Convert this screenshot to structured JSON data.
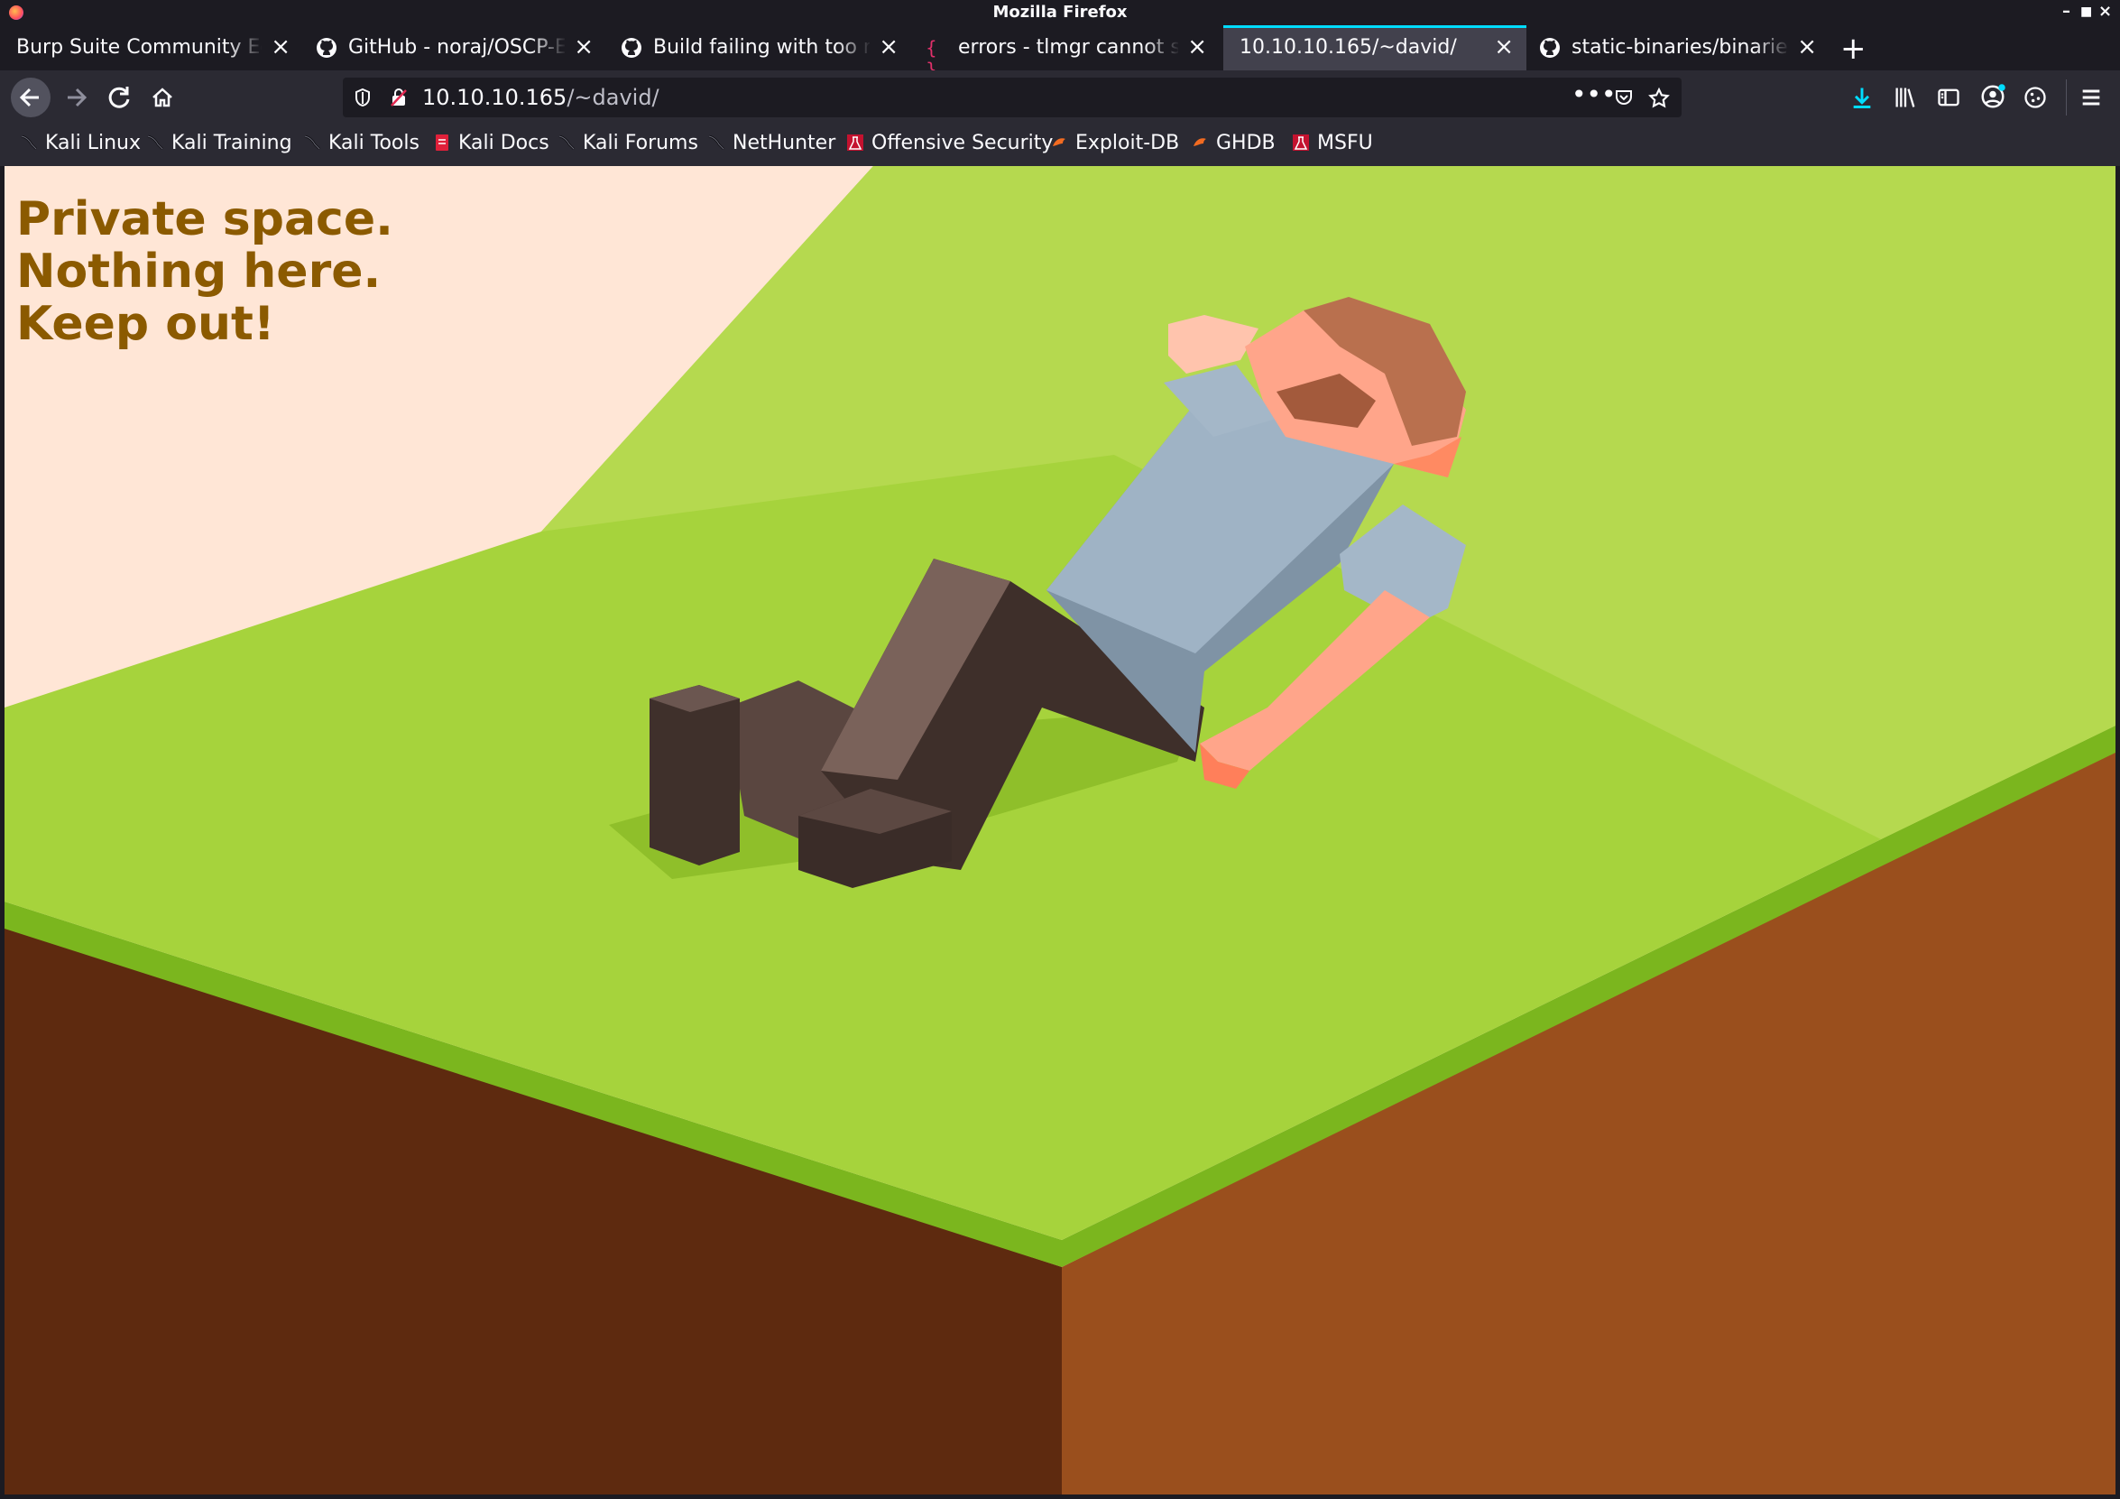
{
  "window": {
    "title": "Mozilla Firefox"
  },
  "tabs": [
    {
      "label": "Burp Suite Community Editio",
      "favicon": "burp-icon",
      "active": false
    },
    {
      "label": "GitHub - noraj/OSCP-Exa",
      "favicon": "github-icon",
      "active": false
    },
    {
      "label": "Build failing with too man",
      "favicon": "github-icon",
      "active": false
    },
    {
      "label": "errors - tlmgr cannot setu",
      "favicon": "braces-icon",
      "active": false
    },
    {
      "label": "10.10.10.165/~david/",
      "favicon": "",
      "active": true
    },
    {
      "label": "static-binaries/binaries/li",
      "favicon": "github-icon",
      "active": false
    }
  ],
  "new_tab_label": "+",
  "url": {
    "host": "10.10.10.165",
    "path": "/~david/"
  },
  "bookmarks": [
    {
      "label": "Kali Linux",
      "icon": "kali-dragon-icon"
    },
    {
      "label": "Kali Training",
      "icon": "kali-dragon-icon"
    },
    {
      "label": "Kali Tools",
      "icon": "kali-dragon-icon"
    },
    {
      "label": "Kali Docs",
      "icon": "kali-docs-icon"
    },
    {
      "label": "Kali Forums",
      "icon": "kali-dragon-icon"
    },
    {
      "label": "NetHunter",
      "icon": "kali-dragon-icon"
    },
    {
      "label": "Offensive Security",
      "icon": "offsec-icon"
    },
    {
      "label": "Exploit-DB",
      "icon": "exploitdb-icon"
    },
    {
      "label": "GHDB",
      "icon": "exploitdb-icon"
    },
    {
      "label": "MSFU",
      "icon": "offsec-icon"
    }
  ],
  "page": {
    "lines": [
      "Private space.",
      "Nothing here.",
      "Keep out!"
    ],
    "text_color": "#8b5a00"
  },
  "colors": {
    "chrome_dark": "#1c1b22",
    "toolbar": "#2b2a33",
    "active_tab": "#42414d",
    "accent": "#00ddff"
  }
}
